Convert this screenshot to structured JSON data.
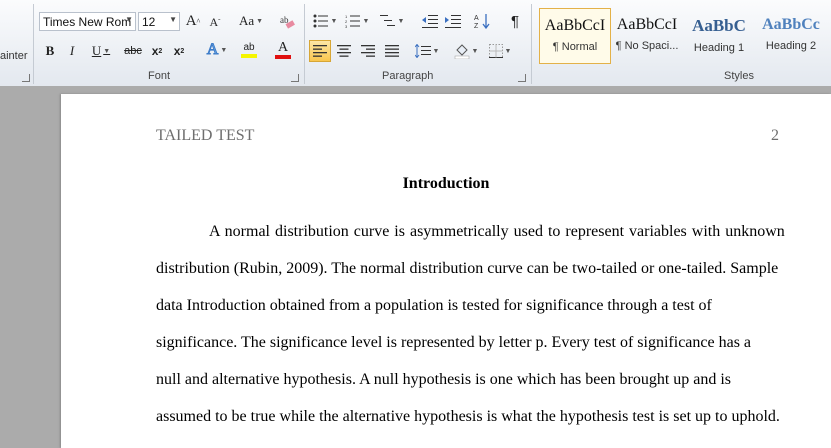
{
  "ribbon": {
    "clipboard_fragment": "ainter",
    "font": {
      "group_label": "Font",
      "font_name": "Times New Rom",
      "font_size": "12",
      "grow_label": "A",
      "shrink_label": "A",
      "change_case_label": "Aa",
      "bold": "B",
      "italic": "I",
      "underline": "U",
      "strike": "abc",
      "subscript": "x",
      "superscript": "x",
      "text_effects": "A",
      "highlight": "ab",
      "font_color": "A",
      "highlight_color": "#f5f500",
      "font_color_value": "#e01010"
    },
    "paragraph": {
      "group_label": "Paragraph",
      "pilcrow": "¶"
    },
    "styles": {
      "group_label": "Styles",
      "items": [
        {
          "sample": "AaBbCcI",
          "name": "¶ Normal",
          "selected": true,
          "color": "#111111"
        },
        {
          "sample": "AaBbCcI",
          "name": "¶ No Spaci...",
          "selected": false,
          "color": "#111111"
        },
        {
          "sample": "AaBbC",
          "name": "Heading 1",
          "selected": false,
          "color": "#365f91"
        },
        {
          "sample": "AaBbCc",
          "name": "Heading 2",
          "selected": false,
          "color": "#4f81bd"
        }
      ]
    }
  },
  "document": {
    "header_left": "TAILED TEST",
    "header_right": "2",
    "title": "Introduction",
    "lines": [
      "A normal distribution curve is asymmetrically used to represent variables with unknown",
      "distribution (Rubin, 2009). The normal distribution curve can be two-tailed or one-tailed. Sample",
      "data Introduction obtained from a population is tested for significance through a test of",
      "significance. The significance level is represented by letter p. Every test of significance has a",
      "null and alternative hypothesis. A null hypothesis is one which has been brought up and is",
      "assumed to be true while the alternative hypothesis is what the hypothesis test is set up to uphold."
    ]
  }
}
